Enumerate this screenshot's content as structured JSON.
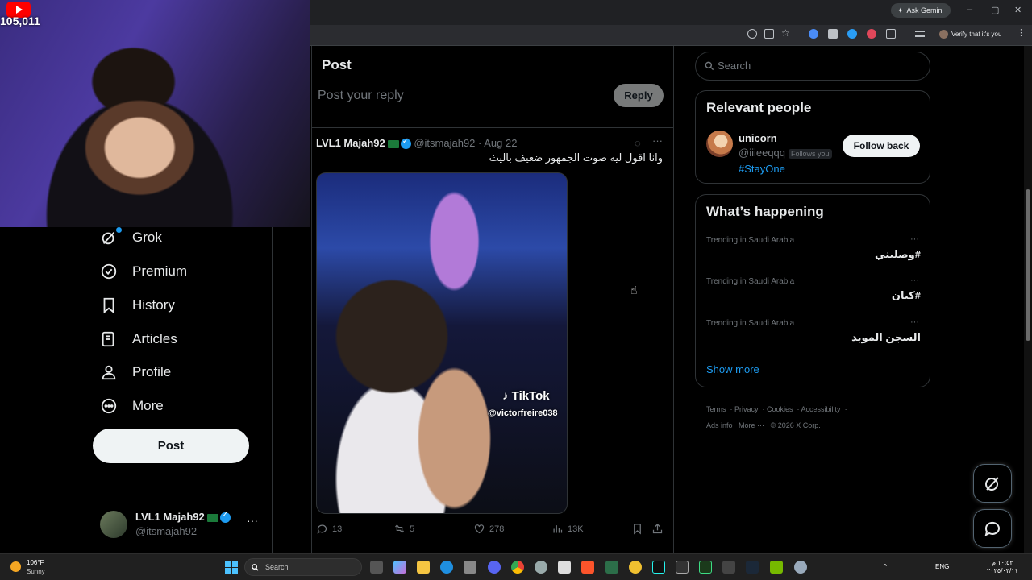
{
  "browser": {
    "ask_gemini": "Ask Gemini",
    "verify_label": "Verify that it's you",
    "window_controls": [
      "–",
      "▢",
      "✕"
    ]
  },
  "stream": {
    "subscriber_count": "105,011"
  },
  "nav": {
    "items": [
      {
        "label": "Grok",
        "icon": "grok-icon"
      },
      {
        "label": "Premium",
        "icon": "premium-icon"
      },
      {
        "label": "History",
        "icon": "bookmark-icon"
      },
      {
        "label": "Articles",
        "icon": "articles-icon"
      },
      {
        "label": "Profile",
        "icon": "profile-icon"
      },
      {
        "label": "More",
        "icon": "more-icon"
      }
    ],
    "post_button": "Post",
    "account": {
      "name": "LVL1 Majah92",
      "handle": "@itsmajah92",
      "more": "···"
    }
  },
  "main": {
    "header": "Post",
    "reply_placeholder": "Post your reply",
    "reply_button": "Reply",
    "tweet": {
      "name": "LVL1 Majah92",
      "meta": " @itsmajah92 · Aug 22",
      "text": "وانا اقول ليه صوت الجمهور ضعيف باليث",
      "tiktok_label": "TikTok",
      "tiktok_user": "@victorfreire038",
      "actions": {
        "replies": "13",
        "reposts": "5",
        "likes": "278",
        "views": "13K"
      }
    }
  },
  "sidebar": {
    "search_placeholder": "Search",
    "relevant_title": "Relevant people",
    "person": {
      "name": "unicorn",
      "handle": "@iiieeqqq",
      "follows_you": "Follows you",
      "bio": "#StayOne",
      "button": "Follow back"
    },
    "happening_title": "What’s happening",
    "trends": [
      {
        "category": "Trending in Saudi Arabia",
        "name": "#وصليني"
      },
      {
        "category": "Trending in Saudi Arabia",
        "name": "#كيان"
      },
      {
        "category": "Trending in Saudi Arabia",
        "name": "السجن الموبد"
      }
    ],
    "show_more": "Show more",
    "footer": [
      "Terms",
      "Privacy",
      "Cookies",
      "Accessibility",
      "Ads info",
      "More ···",
      "© 2026 X Corp."
    ]
  },
  "taskbar": {
    "weather_temp": "106°F",
    "weather_cond": "Sunny",
    "search_label": "Search",
    "lang": "ENG",
    "clock_time": "١٠:٥٣ م",
    "clock_date": "٢٠٢٥/٠٣/١١"
  },
  "colors": {
    "accent": "#1d9bf0",
    "background": "#000000",
    "muted": "#71767b"
  }
}
